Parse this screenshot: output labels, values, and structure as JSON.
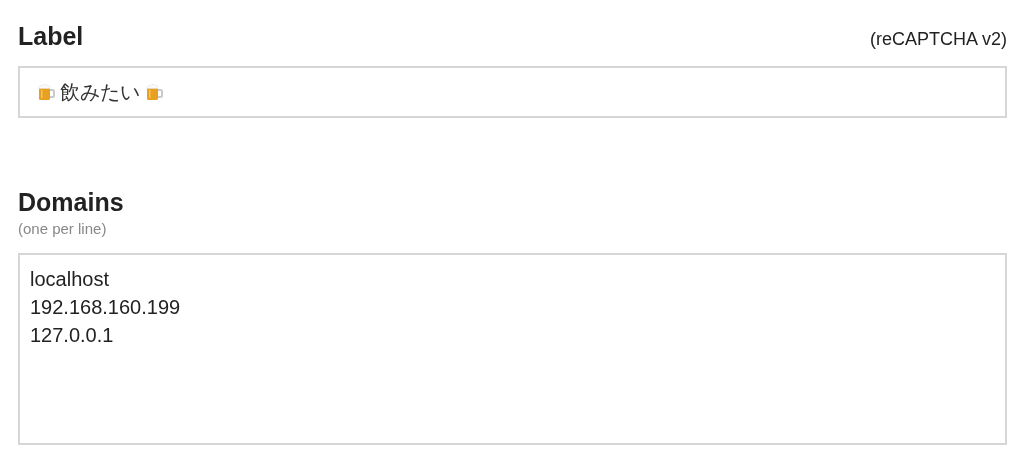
{
  "label_section": {
    "heading": "Label",
    "note": "(reCAPTCHA v2)",
    "field": {
      "value": "飲みたい"
    }
  },
  "domains_section": {
    "heading": "Domains",
    "hint": "(one per line)",
    "field": {
      "lines": [
        "localhost",
        "192.168.160.199",
        "127.0.0.1"
      ]
    }
  }
}
